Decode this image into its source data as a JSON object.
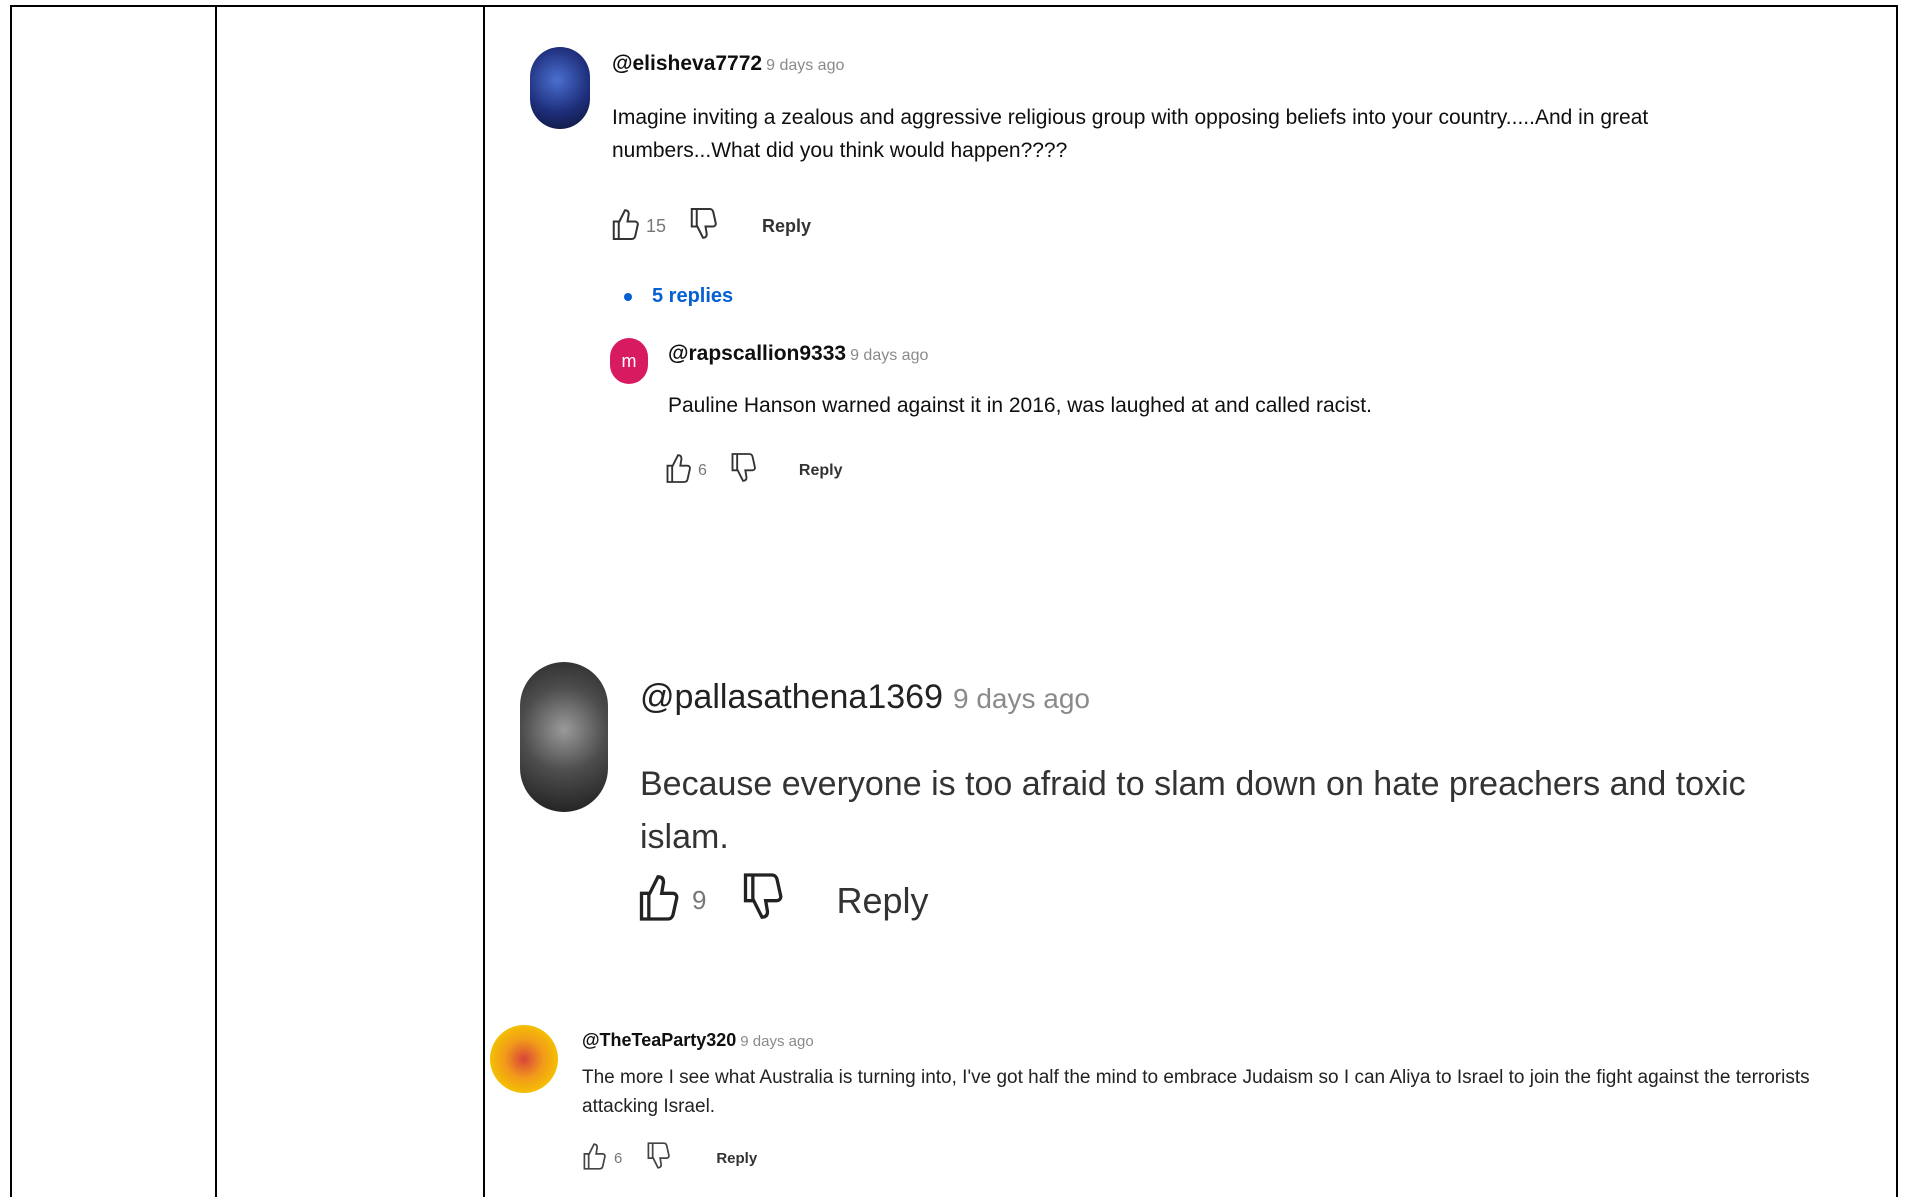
{
  "colors": {
    "link": "#065fd4",
    "border": "#000000",
    "meta": "#8a8a8a",
    "avatar_reply": "#d81b60",
    "avatar_yellow": "#f4c400"
  },
  "comments": [
    {
      "handle": "@elisheva7772",
      "age": "9 days ago",
      "text": "Imagine inviting a zealous and aggressive religious group with opposing beliefs into your country.....And in great numbers...What did you think would happen????",
      "likes": "15",
      "reply_label": "Reply",
      "replies_label": "5 replies"
    },
    {
      "handle": "@rapscallion9333",
      "age": "9 days ago",
      "avatar_letter": "m",
      "text": "Pauline Hanson warned against it in 2016, was laughed at and called racist.",
      "likes": "6",
      "reply_label": "Reply"
    },
    {
      "handle": "@pallasathena1369",
      "age": "9 days ago",
      "text": "Because everyone is too afraid to slam down on hate preachers and toxic islam.",
      "likes": "9",
      "reply_label": "Reply"
    },
    {
      "handle": "@TheTeaParty320",
      "age": "9 days ago",
      "text": "The more I see what Australia is turning into, I've got half the mind to embrace Judaism so I can Aliya to Israel to join the fight against the terrorists attacking Israel.",
      "likes": "6",
      "reply_label": "Reply"
    }
  ]
}
